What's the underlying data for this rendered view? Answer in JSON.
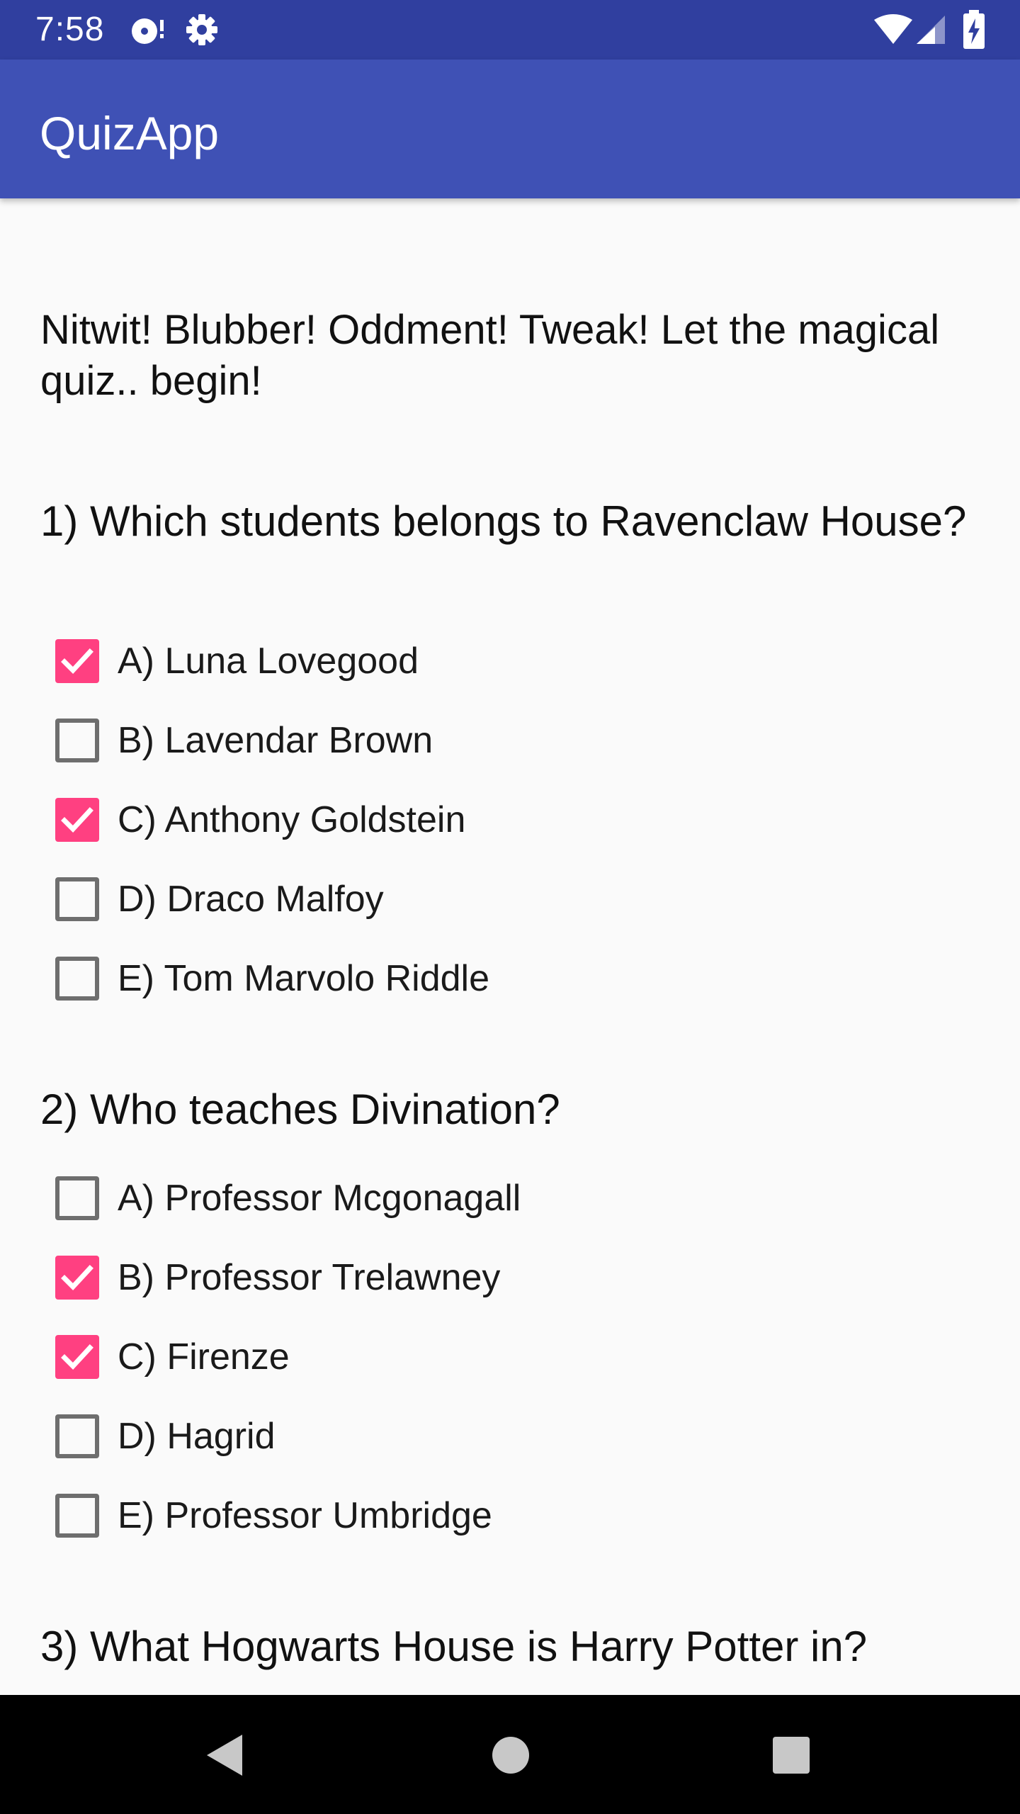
{
  "status_bar": {
    "time": "7:58",
    "icons": [
      "media-playback-icon",
      "settings-gear-icon",
      "wifi-icon",
      "cell-signal-icon",
      "battery-charging-icon"
    ]
  },
  "app_bar": {
    "title": "QuizApp"
  },
  "intro": {
    "text": "Nitwit! Blubber! Oddment! Tweak! Let the magical quiz.. begin!"
  },
  "questions": [
    {
      "text": "1) Which students belongs to Ravenclaw House?",
      "options": [
        {
          "label": "A) Luna Lovegood",
          "checked": true
        },
        {
          "label": "B) Lavendar Brown",
          "checked": false
        },
        {
          "label": "C) Anthony Goldstein",
          "checked": true
        },
        {
          "label": "D) Draco Malfoy",
          "checked": false
        },
        {
          "label": "E) Tom Marvolo Riddle",
          "checked": false
        }
      ]
    },
    {
      "text": "2) Who teaches Divination?",
      "options": [
        {
          "label": "A) Professor Mcgonagall",
          "checked": false
        },
        {
          "label": "B) Professor Trelawney",
          "checked": true
        },
        {
          "label": "C) Firenze",
          "checked": true
        },
        {
          "label": "D) Hagrid",
          "checked": false
        },
        {
          "label": "E) Professor Umbridge",
          "checked": false
        }
      ]
    },
    {
      "text": "3) What Hogwarts House is Harry Potter in?"
    }
  ],
  "nav_bar": {
    "buttons": [
      "back-icon",
      "home-icon",
      "recents-icon"
    ]
  },
  "colors": {
    "status_bar": "#303f9f",
    "app_bar": "#3f51b5",
    "accent": "#ff4081",
    "background": "#fafafa"
  }
}
